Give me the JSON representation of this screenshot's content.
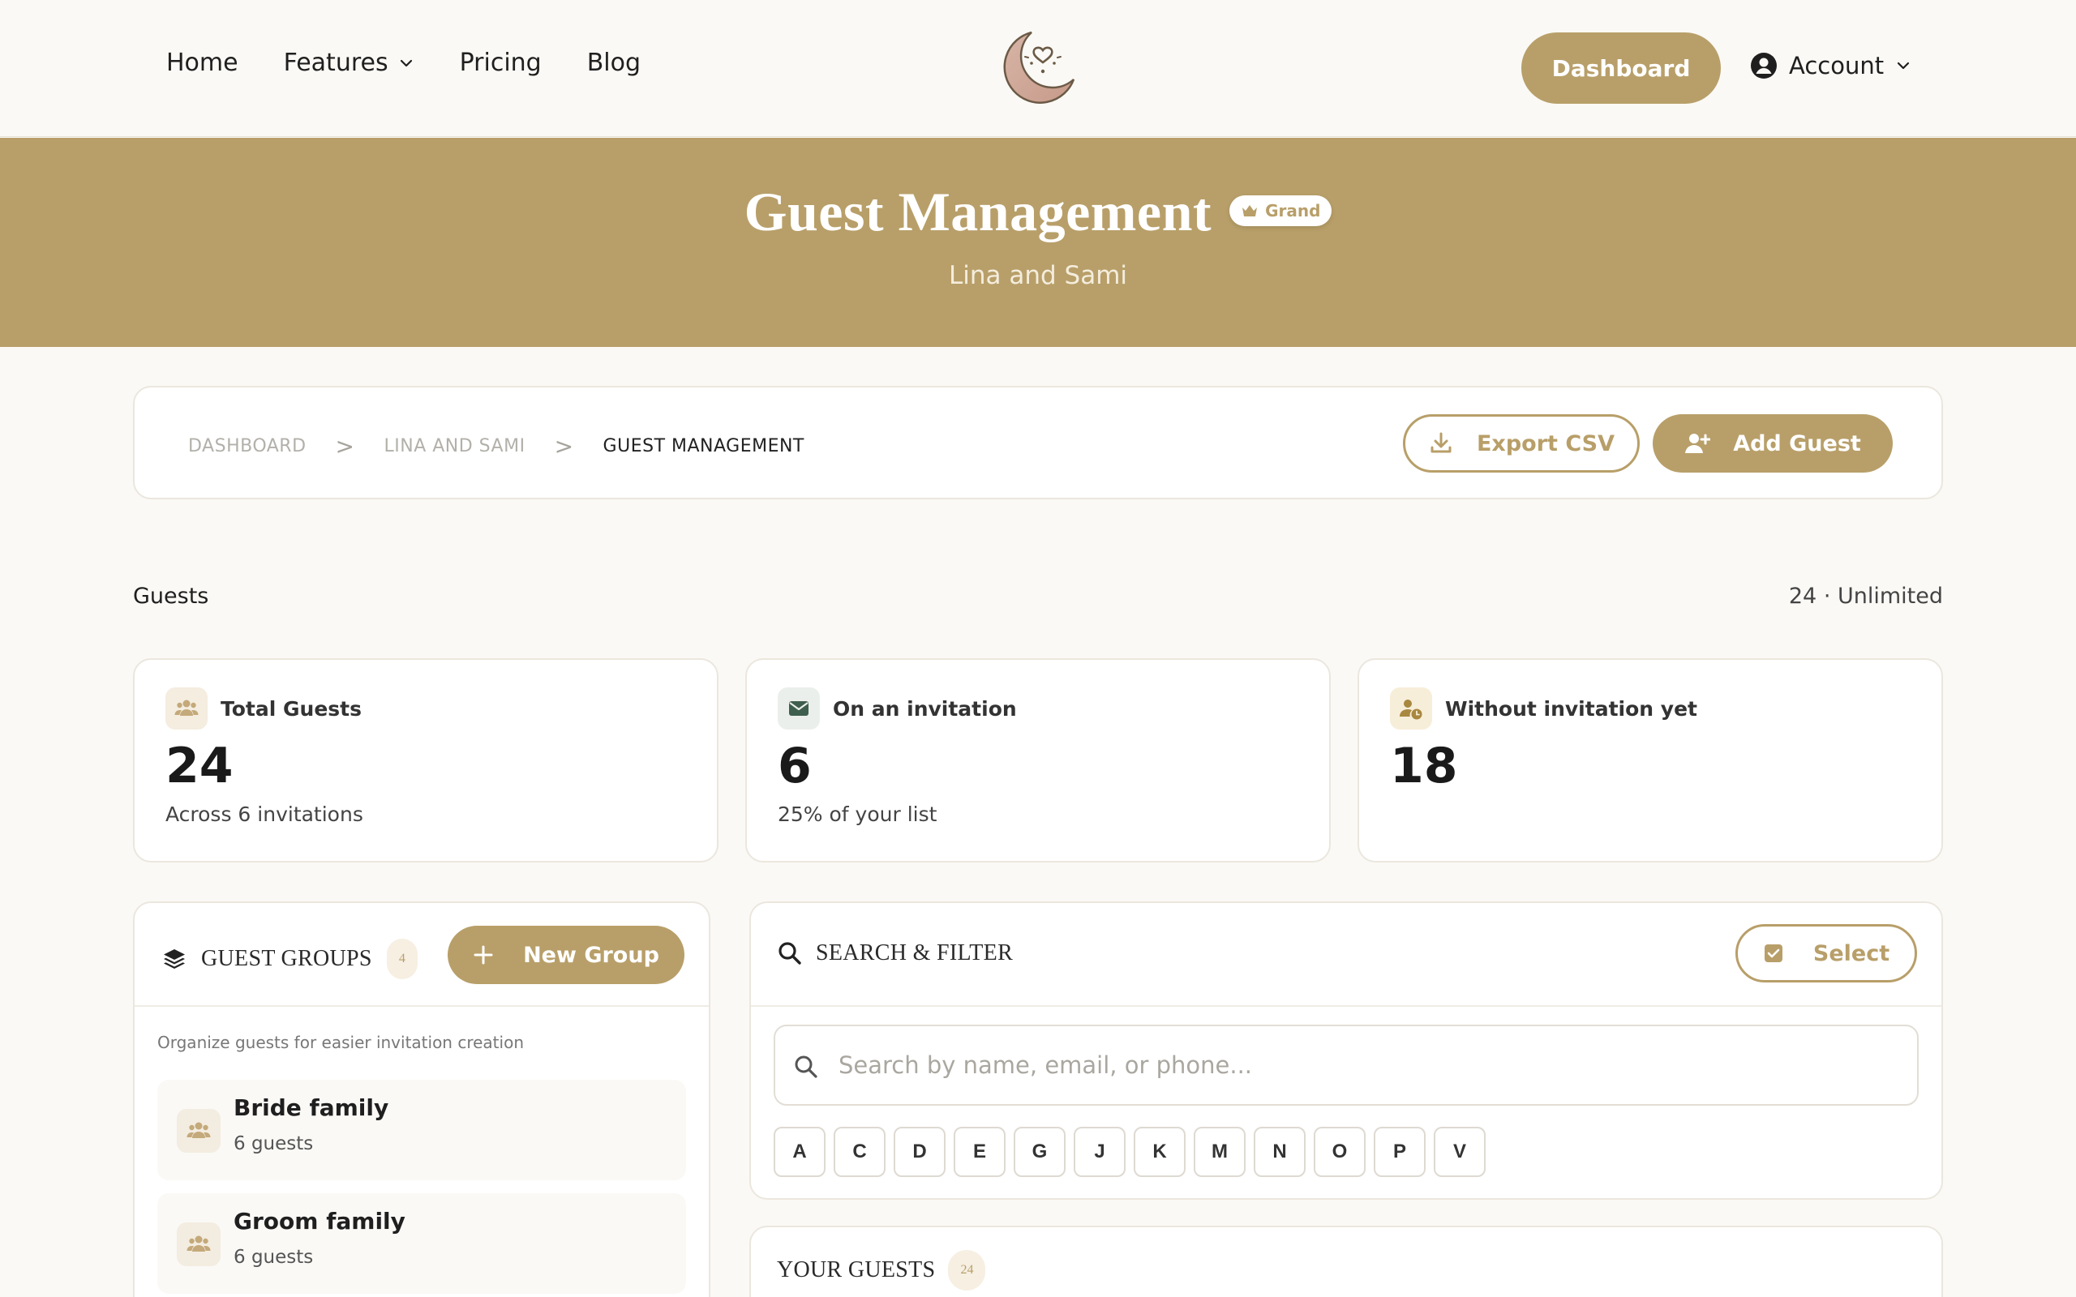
{
  "nav": {
    "links": [
      {
        "label": "Home"
      },
      {
        "label": "Features"
      },
      {
        "label": "Pricing"
      },
      {
        "label": "Blog"
      }
    ],
    "dashboard_label": "Dashboard",
    "account_label": "Account"
  },
  "hero": {
    "title": "Guest Management",
    "plan_badge": "Grand",
    "subtitle": "Lina and Sami"
  },
  "breadcrumb": {
    "items": [
      "DASHBOARD",
      "LINA AND SAMI",
      "GUEST MANAGEMENT"
    ],
    "separator": ">"
  },
  "actions": {
    "export_label": "Export CSV",
    "add_label": "Add Guest"
  },
  "guests": {
    "label": "Guests",
    "quota": "24 · Unlimited"
  },
  "stats": [
    {
      "title": "Total Guests",
      "value": "24",
      "note": "Across 6 invitations",
      "icon": "users-icon"
    },
    {
      "title": "On an invitation",
      "value": "6",
      "note": "25% of your list",
      "icon": "envelope-icon"
    },
    {
      "title": "Without invitation yet",
      "value": "18",
      "note": "",
      "icon": "user-clock-icon"
    }
  ],
  "groups": {
    "title": "GUEST GROUPS",
    "count": "4",
    "new_group_label": "New Group",
    "help": "Organize guests for easier invitation creation",
    "items": [
      {
        "name": "Bride family",
        "count": "6 guests"
      },
      {
        "name": "Groom family",
        "count": "6 guests"
      }
    ]
  },
  "search": {
    "title": "SEARCH & FILTER",
    "select_label": "Select",
    "placeholder": "Search by name, email, or phone...",
    "letters": [
      "A",
      "C",
      "D",
      "E",
      "G",
      "J",
      "K",
      "M",
      "N",
      "O",
      "P",
      "V"
    ]
  },
  "your_guests": {
    "title": "YOUR GUESTS",
    "count": "24"
  },
  "colors": {
    "accent": "#b89f69",
    "background": "#faf9f5",
    "card": "#ffffff",
    "text": "#1f1f1f",
    "envelope": "#3f5f4e"
  }
}
